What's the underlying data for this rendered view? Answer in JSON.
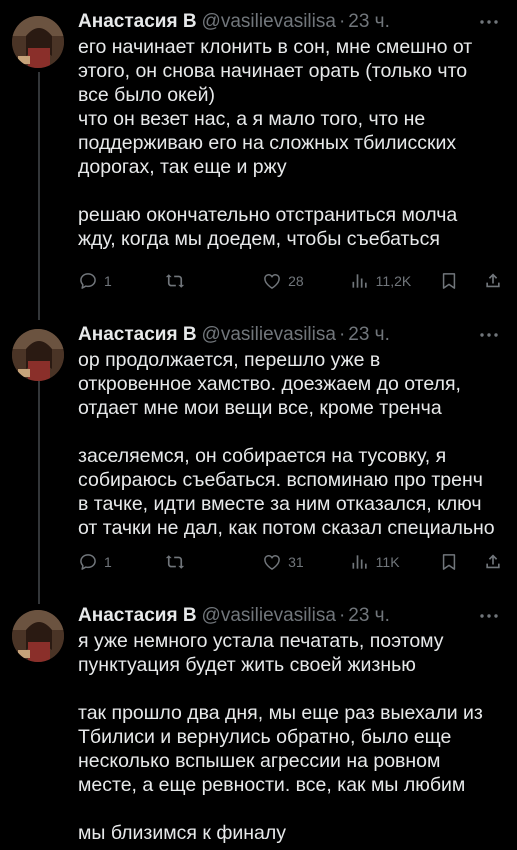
{
  "tweets": [
    {
      "author_name": "Анастасия В",
      "handle": "@vasilievasilisa",
      "separator": "·",
      "time": "23 ч.",
      "text": "его начинает клонить в сон, мне смешно от\nэтого, он снова начинает орать (только что\nвсе было окей)\nчто он везет нас, а я мало того, что не\nподдерживаю его на сложных тбилисских\nдорогах, так еще и ржу\n\nрешаю окончательно отстраниться молча\nжду, когда мы доедем, чтобы съебаться",
      "replies": "1",
      "retweets": "",
      "likes": "28",
      "views": "11,2K"
    },
    {
      "author_name": "Анастасия В",
      "handle": "@vasilievasilisa",
      "separator": "·",
      "time": "23 ч.",
      "text": "ор продолжается, перешло уже в\nоткровенное хамство. доезжаем до отеля,\nотдает мне мои вещи все, кроме тренча\n\nзаселяемся, он собирается на тусовку, я\nсобираюсь съебаться. вспоминаю про тренч\nв тачке, идти вместе за ним отказался, ключ\nот тачки не дал, как потом сказал специально",
      "replies": "1",
      "retweets": "",
      "likes": "31",
      "views": "11K"
    },
    {
      "author_name": "Анастасия В",
      "handle": "@vasilievasilisa",
      "separator": "·",
      "time": "23 ч.",
      "text": "я уже немного устала печатать, поэтому\nпунктуация будет жить своей жизнью\n\nтак прошло два дня, мы еще раз выехали из\nТбилиси и вернулись обратно, было еще\nнесколько вспышек агрессии на ровном\nместе, а еще ревности. все, как мы любим\n\nмы близимся к финалу"
    }
  ],
  "icons": {
    "more": "more-icon",
    "reply": "reply-icon",
    "retweet": "retweet-icon",
    "like": "like-icon",
    "views": "views-icon",
    "bookmark": "bookmark-icon",
    "share": "share-icon"
  },
  "colors": {
    "background": "#000000",
    "text": "#e7e9ea",
    "secondary": "#71767b",
    "thread_line": "#333639"
  }
}
